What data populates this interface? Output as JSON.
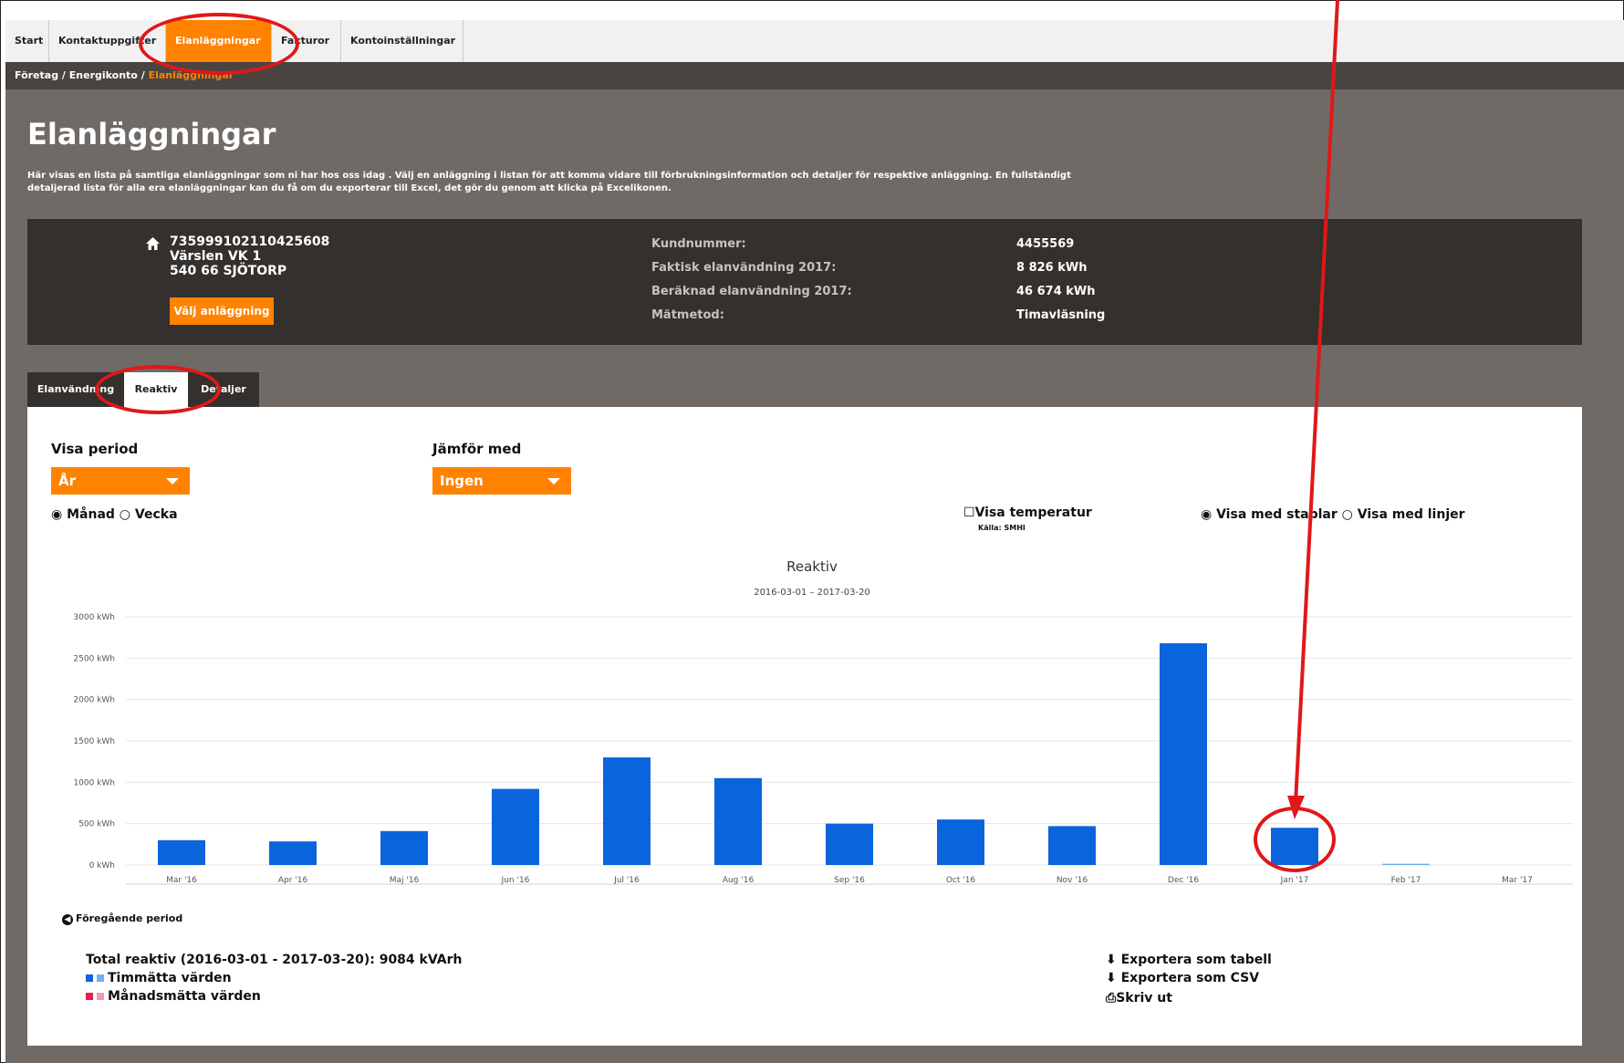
{
  "nav": {
    "tabs": [
      "Start",
      "Kontaktuppgifter",
      "Elanläggningar",
      "Fakturor",
      "Kontoinställningar"
    ]
  },
  "breadcrumb": {
    "part1": "Företag",
    "sep": " / ",
    "part2": "Energikonto",
    "current": "Elanläggningar"
  },
  "page": {
    "title": "Elanläggningar",
    "intro_line1": "Här visas en lista på samtliga elanläggningar som ni har hos oss idag . Välj en anläggning i listan för att komma vidare till förbrukningsinformation och detaljer för respektive anläggning. En fullständigt",
    "intro_line2": "detaljerad lista för alla era elanläggningar kan du få om du exporterar till Excel, det gör du genom att klicka på Excelikonen."
  },
  "facility": {
    "id": "735999102110425608",
    "street": "Värslen VK 1",
    "city": "540 66 SJÖTORP",
    "select_button": "Välj anläggning",
    "rows": [
      {
        "label": "Kundnummer:",
        "value": "4455569"
      },
      {
        "label": "Faktisk elanvändning 2017:",
        "value": "8 826 kWh"
      },
      {
        "label": "Beräknad elanvändning 2017:",
        "value": "46 674 kWh"
      },
      {
        "label": "Mätmetod:",
        "value": "Timavläsning"
      }
    ]
  },
  "subtabs": [
    "Elanvändning",
    "Reaktiv",
    "Detaljer"
  ],
  "filters": {
    "period_label": "Visa period",
    "period_value": "År",
    "compare_label": "Jämför med",
    "compare_value": "Ingen",
    "radio_month": "Månad",
    "radio_week": "Vecka",
    "temp_label": "Visa temperatur",
    "temp_source": "Källa: SMHI",
    "radio_bars": "Visa med staplar",
    "radio_lines": "Visa med linjer"
  },
  "chart_data": {
    "type": "bar",
    "title": "Reaktiv",
    "subtitle": "2016-03-01 – 2017-03-20",
    "categories": [
      "Mar '16",
      "Apr '16",
      "Maj '16",
      "Jun '16",
      "Jul '16",
      "Aug '16",
      "Sep '16",
      "Oct '16",
      "Nov '16",
      "Dec '16",
      "Jan '17",
      "Feb '17",
      "Mar '17"
    ],
    "values": [
      300,
      285,
      410,
      920,
      1300,
      1050,
      500,
      550,
      470,
      2680,
      450,
      15,
      0
    ],
    "ylim": [
      0,
      3000
    ],
    "yticks": [
      "0 kWh",
      "500 kWh",
      "1000 kWh",
      "1500 kWh",
      "2000 kWh",
      "2500 kWh",
      "3000 kWh"
    ],
    "grid": true,
    "color": "#0a64dc"
  },
  "footer": {
    "prev_period": "Föregående period",
    "total": "Total reaktiv (2016-03-01 - 2017-03-20): 9084 kVArh",
    "legend1": "Timmätta värden",
    "legend2": "Månadsmätta värden",
    "export_table": "Exportera som tabell",
    "export_csv": "Exportera som CSV",
    "print": "Skriv ut"
  },
  "colors": {
    "accent": "#ff8200",
    "bar": "#0a64dc",
    "bar_light": "#6fb0ec",
    "monthly": "#e0244a",
    "monthly_light": "#f29ab0",
    "annotation": "#e01818"
  }
}
